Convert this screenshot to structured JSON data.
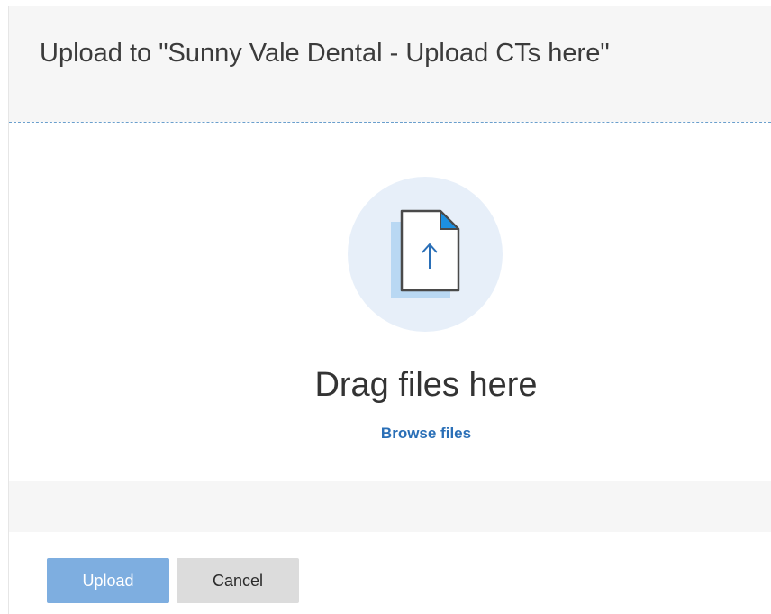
{
  "dialog": {
    "title": "Upload to \"Sunny Vale Dental - Upload CTs here\""
  },
  "dropzone": {
    "illustration_icon": "file-upload-icon",
    "drag_label": "Drag files here",
    "browse_label": "Browse files"
  },
  "footer": {
    "upload_label": "Upload",
    "cancel_label": "Cancel",
    "upload_disabled": true
  },
  "colors": {
    "accent": "#2a6fb7",
    "upload_button_disabled": "#7eaee0",
    "cancel_button": "#dcdcdc",
    "illustration_circle": "#e7eff9",
    "divider": "#6a9fcd"
  }
}
